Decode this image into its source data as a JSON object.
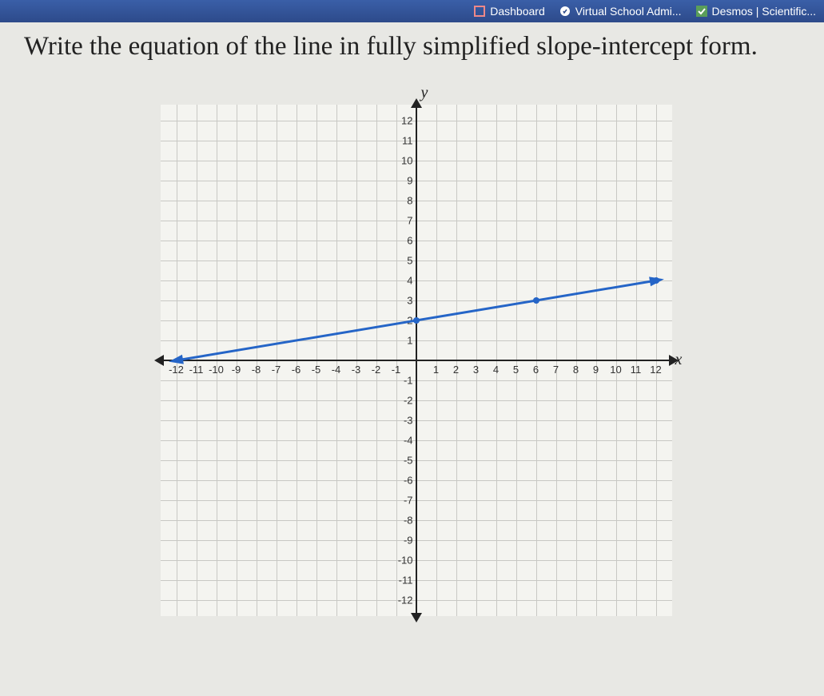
{
  "header": {
    "bookmarks": [
      {
        "label": "Dashboard",
        "icon": "dashboard-icon"
      },
      {
        "label": "Virtual School Admi...",
        "icon": "virtual-school-icon"
      },
      {
        "label": "Desmos | Scientific...",
        "icon": "desmos-icon"
      }
    ]
  },
  "question": "Write the equation of the line in fully simplified slope-intercept form.",
  "chart_data": {
    "type": "line",
    "xlabel": "x",
    "ylabel": "y",
    "xlim": [
      -12,
      12
    ],
    "ylim": [
      -12,
      12
    ],
    "x_ticks": [
      -12,
      -11,
      -10,
      -9,
      -8,
      -7,
      -6,
      -5,
      -4,
      -3,
      -2,
      -1,
      1,
      2,
      3,
      4,
      5,
      6,
      7,
      8,
      9,
      10,
      11,
      12
    ],
    "y_ticks": [
      -12,
      -11,
      -10,
      -9,
      -8,
      -7,
      -6,
      -5,
      -4,
      -3,
      -2,
      -1,
      1,
      2,
      3,
      4,
      5,
      6,
      7,
      8,
      9,
      10,
      11,
      12
    ],
    "line_points": [
      {
        "x": -12,
        "y": 0
      },
      {
        "x": 0,
        "y": 2
      },
      {
        "x": 6,
        "y": 3
      },
      {
        "x": 12,
        "y": 4
      }
    ],
    "marked_points": [
      {
        "x": 0,
        "y": 2
      },
      {
        "x": 6,
        "y": 3
      },
      {
        "x": 12,
        "y": 4
      }
    ],
    "slope": 0.1666667,
    "intercept": 2
  }
}
